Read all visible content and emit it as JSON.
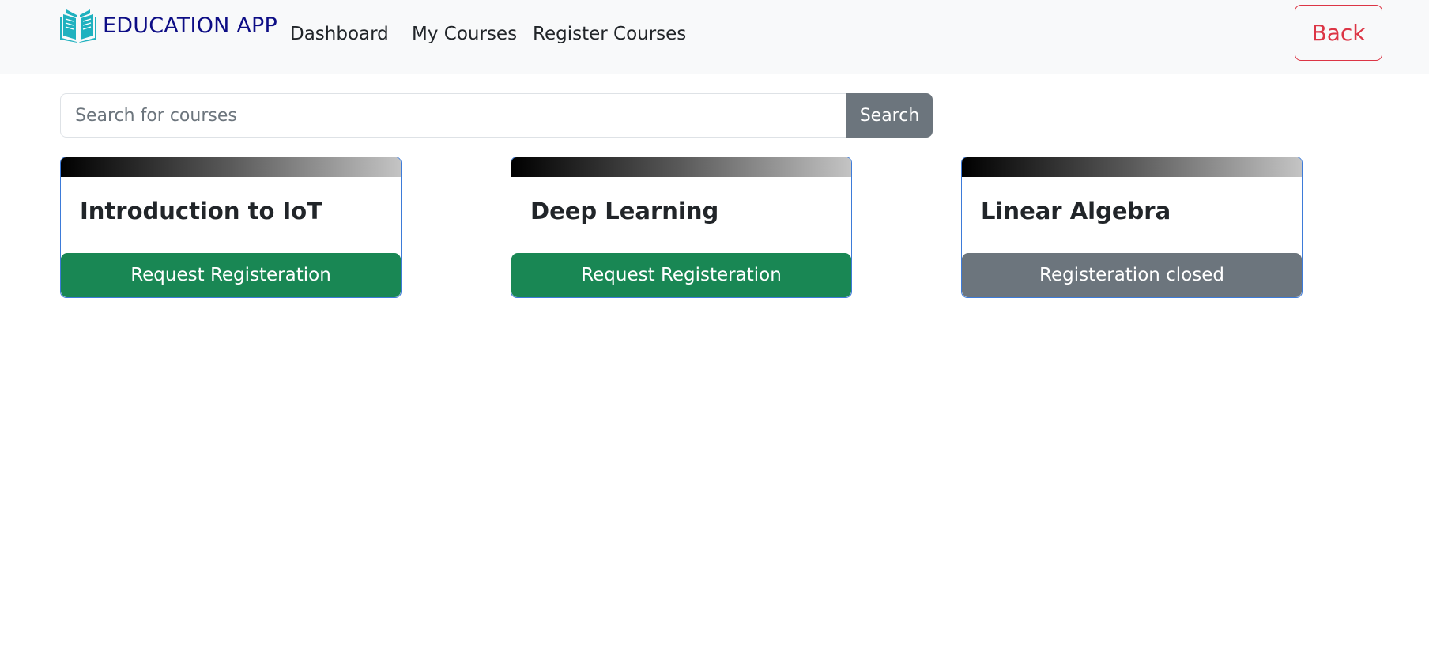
{
  "navbar": {
    "brand": "EDUCATION APP",
    "brand_icon": "open-book-icon",
    "brand_color": "#0d0d85",
    "icon_color": "#1fb1bf",
    "links": [
      "Dashboard",
      "My Courses",
      "Register Courses"
    ],
    "back_label": "Back"
  },
  "search": {
    "placeholder": "Search for courses",
    "value": "",
    "button_label": "Search"
  },
  "courses": [
    {
      "title": "Introduction to IoT",
      "action": "Request Registeration",
      "status": "open",
      "button_color": "#198754"
    },
    {
      "title": "Deep Learning",
      "action": "Request Registeration",
      "status": "open",
      "button_color": "#198754"
    },
    {
      "title": "Linear Algebra",
      "action": "Registeration closed",
      "status": "closed",
      "button_color": "#6c757d"
    }
  ]
}
